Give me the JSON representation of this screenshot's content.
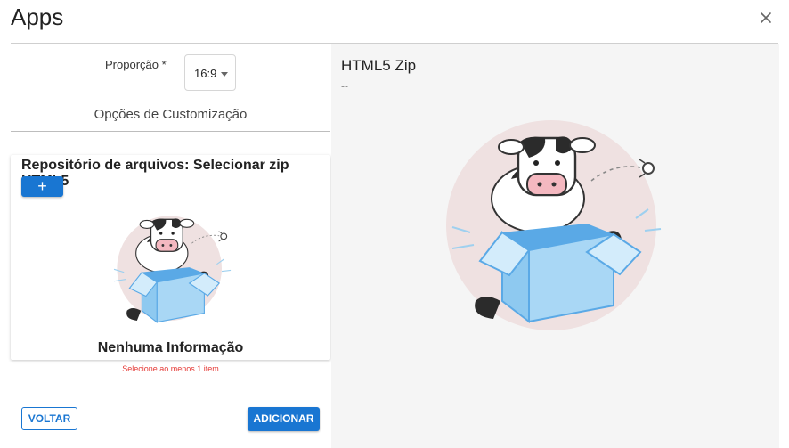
{
  "dialog": {
    "title": "Apps"
  },
  "form": {
    "proportion_label": "Proporção *",
    "proportion_value": "16:9",
    "options_title": "Opções de Customização"
  },
  "repository": {
    "title": "Repositório de arquivos: Selecionar zip HTML5",
    "add_label": "+",
    "empty_label": "Nenhuma Informação",
    "warning": "Selecione ao menos 1 item"
  },
  "footer": {
    "back_label": "VOLTAR",
    "add_label": "ADICIONAR"
  },
  "preview": {
    "title": "HTML5 Zip",
    "subtitle": "--"
  },
  "colors": {
    "accent": "#1976d2",
    "error": "#e53935",
    "preview_bg": "#f5f5f5"
  }
}
